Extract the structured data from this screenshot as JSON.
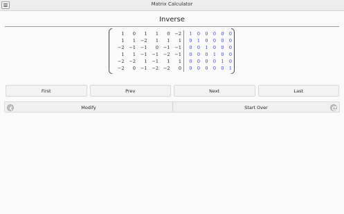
{
  "window": {
    "title": "Matrix Calculator",
    "menu_icon": "hamburger-menu-icon"
  },
  "page": {
    "heading": "Inverse"
  },
  "matrix": {
    "left": [
      [
        "1",
        "0",
        "1",
        "1",
        "0",
        "−2"
      ],
      [
        "1",
        "1",
        "−2",
        "1",
        "1",
        "1"
      ],
      [
        "−2",
        "−1",
        "−1",
        "0",
        "−1",
        "−1"
      ],
      [
        "1",
        "1",
        "−1",
        "−1",
        "−2",
        "−1"
      ],
      [
        "−2",
        "−2",
        "1",
        "−1",
        "1",
        "1"
      ],
      [
        "−2",
        "0",
        "−1",
        "−2",
        "−2",
        "0"
      ]
    ],
    "right": [
      [
        "1",
        "0",
        "0",
        "0",
        "0",
        "0"
      ],
      [
        "0",
        "1",
        "0",
        "0",
        "0",
        "0"
      ],
      [
        "0",
        "0",
        "1",
        "0",
        "0",
        "0"
      ],
      [
        "0",
        "0",
        "0",
        "1",
        "0",
        "0"
      ],
      [
        "0",
        "0",
        "0",
        "0",
        "1",
        "0"
      ],
      [
        "0",
        "0",
        "0",
        "0",
        "0",
        "1"
      ]
    ],
    "right_color": "#3a3ad0"
  },
  "nav": {
    "first": "First",
    "prev": "Prev",
    "next": "Next",
    "last": "Last"
  },
  "actions": {
    "modify": "Modify",
    "start_over": "Start Over",
    "back_icon": "back-arrow-icon",
    "refresh_icon": "refresh-icon"
  }
}
